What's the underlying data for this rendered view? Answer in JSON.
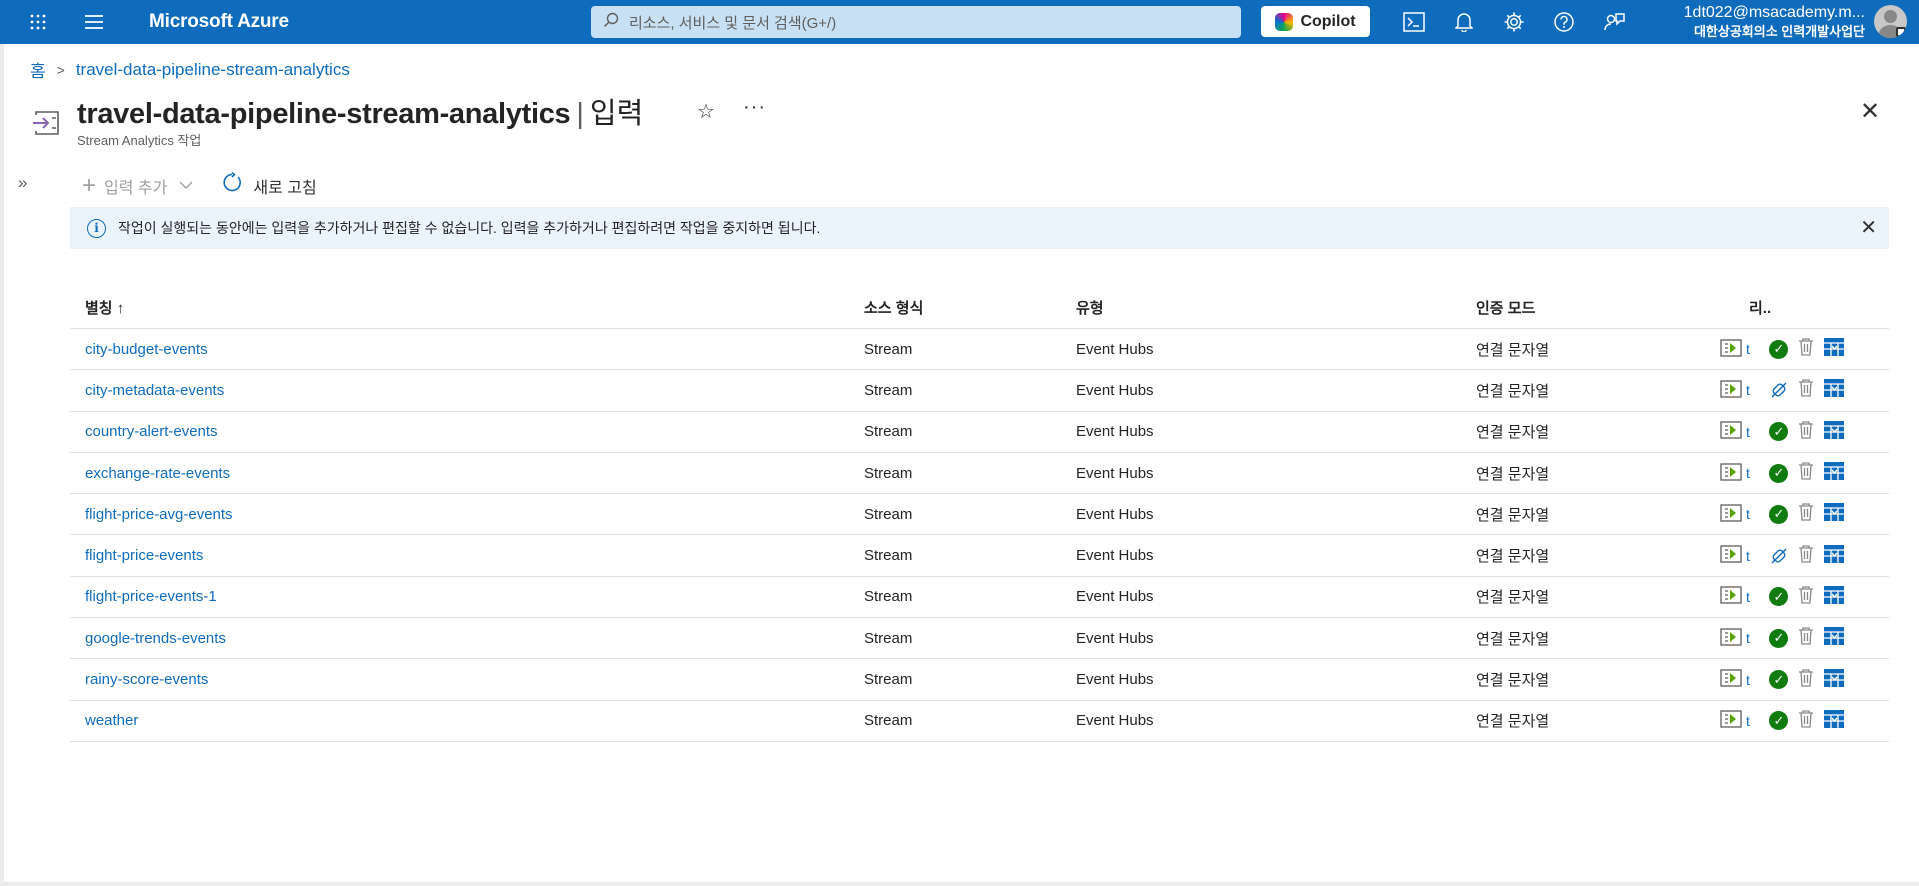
{
  "topbar": {
    "brand": "Microsoft Azure",
    "search_placeholder": "리소스, 서비스 및 문서 검색(G+/)",
    "copilot_label": "Copilot",
    "user_email": "1dt022@msacademy.m...",
    "user_org": "대한상공회의소 인력개발사업단",
    "icons": [
      "waffle-icon",
      "menu-icon",
      "search-icon",
      "cloud-shell-icon",
      "bell-icon",
      "gear-icon",
      "help-icon",
      "feedback-icon",
      "avatar"
    ],
    "accent": "#0f6cbd"
  },
  "breadcrumb": {
    "home": "홈",
    "current": "travel-data-pipeline-stream-analytics"
  },
  "header": {
    "resource_name": "travel-data-pipeline-stream-analytics",
    "separator": "|",
    "section": "입력",
    "subtitle": "Stream Analytics 작업",
    "more": "···"
  },
  "toolbar": {
    "add_input": "입력 추가",
    "refresh": "새로 고침"
  },
  "info_bar": {
    "message": "작업이 실행되는 동안에는 입력을 추가하거나 편집할 수 없습니다. 입력을 추가하거나 편집하려면 작업을 중지하면 됩니다."
  },
  "table": {
    "columns": [
      "별칭 ↑",
      "소스 형식",
      "유형",
      "인증 모드",
      "리.."
    ],
    "test_label": "t",
    "rows": [
      {
        "alias": "city-budget-events",
        "source": "Stream",
        "type": "Event Hubs",
        "auth": "연결 문자열",
        "status": "ok"
      },
      {
        "alias": "city-metadata-events",
        "source": "Stream",
        "type": "Event Hubs",
        "auth": "연결 문자열",
        "status": "disconnected"
      },
      {
        "alias": "country-alert-events",
        "source": "Stream",
        "type": "Event Hubs",
        "auth": "연결 문자열",
        "status": "ok"
      },
      {
        "alias": "exchange-rate-events",
        "source": "Stream",
        "type": "Event Hubs",
        "auth": "연결 문자열",
        "status": "ok"
      },
      {
        "alias": "flight-price-avg-events",
        "source": "Stream",
        "type": "Event Hubs",
        "auth": "연결 문자열",
        "status": "ok"
      },
      {
        "alias": "flight-price-events",
        "source": "Stream",
        "type": "Event Hubs",
        "auth": "연결 문자열",
        "status": "disconnected"
      },
      {
        "alias": "flight-price-events-1",
        "source": "Stream",
        "type": "Event Hubs",
        "auth": "연결 문자열",
        "status": "ok"
      },
      {
        "alias": "google-trends-events",
        "source": "Stream",
        "type": "Event Hubs",
        "auth": "연결 문자열",
        "status": "ok"
      },
      {
        "alias": "rainy-score-events",
        "source": "Stream",
        "type": "Event Hubs",
        "auth": "연결 문자열",
        "status": "ok"
      },
      {
        "alias": "weather",
        "source": "Stream",
        "type": "Event Hubs",
        "auth": "연결 문자열",
        "status": "ok"
      }
    ]
  }
}
